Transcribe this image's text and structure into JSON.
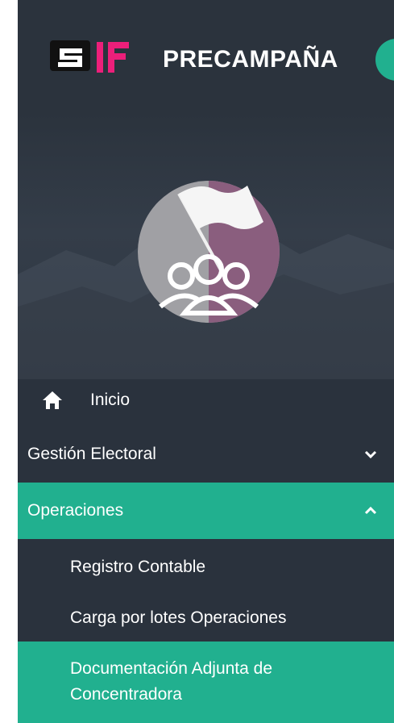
{
  "header": {
    "brand": "PRECAMPAÑA",
    "logo_text": "SIF"
  },
  "profile": {
    "avatar_icon": "flag-group-icon"
  },
  "menu": {
    "inicio": "Inicio",
    "gestion_electoral": "Gestión Electoral",
    "operaciones": "Operaciones",
    "submenu": {
      "registro_contable": "Registro Contable",
      "carga_por_lotes": "Carga por lotes Operaciones",
      "documentacion_line1": "Documentación Adjunta de",
      "documentacion_line2": "Concentradora"
    }
  },
  "colors": {
    "sidebar_bg": "#2a323d",
    "accent": "#21b08f",
    "logo_pink": "#ec1f7a"
  }
}
